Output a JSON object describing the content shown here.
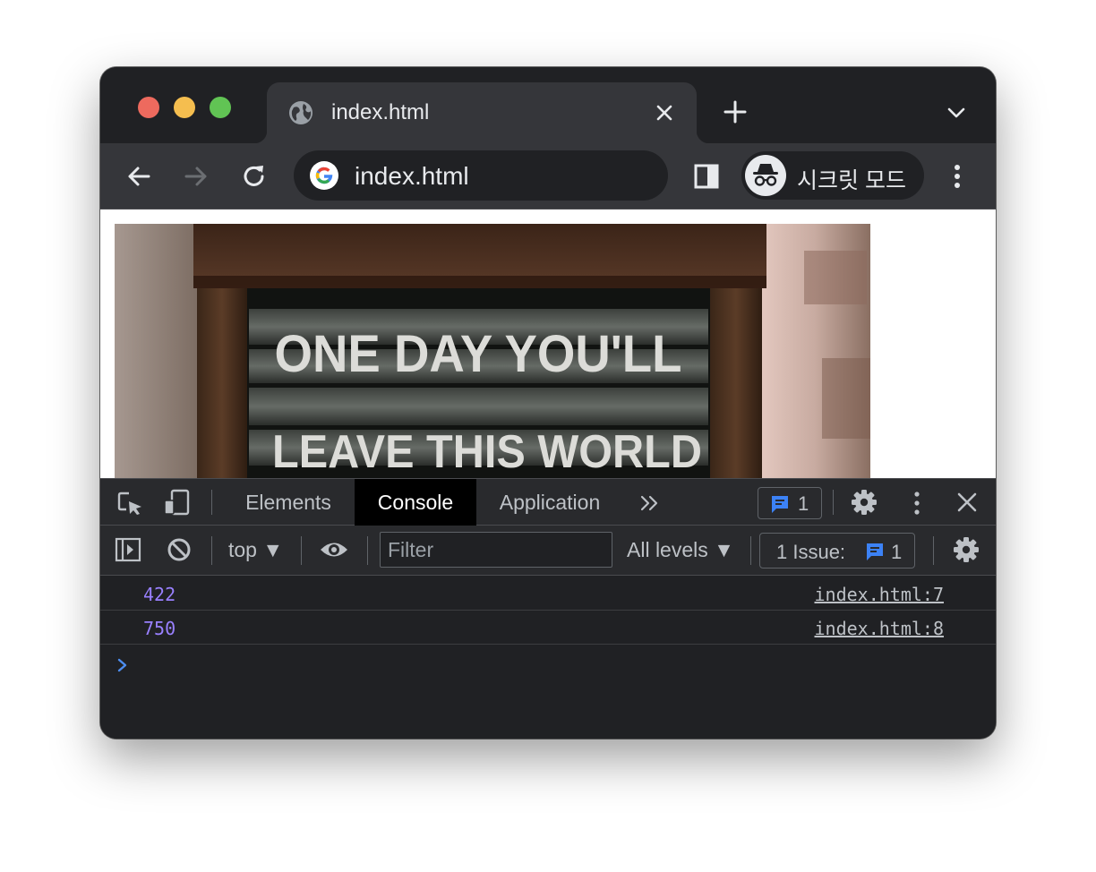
{
  "browser": {
    "tab": {
      "title": "index.html"
    },
    "omnibox": {
      "url": "index.html"
    },
    "incognito_label": "시크릿 모드"
  },
  "page": {
    "image_text": "ONE DAY YOU'LL LEAVE THIS WORLD"
  },
  "devtools": {
    "tabs": [
      {
        "label": "Elements",
        "active": false
      },
      {
        "label": "Console",
        "active": true
      },
      {
        "label": "Application",
        "active": false
      }
    ],
    "issues_badge_count": "1",
    "console_toolbar": {
      "context": "top ▼",
      "filter_placeholder": "Filter",
      "levels": "All levels ▼",
      "issues_label": "1 Issue:",
      "issues_count": "1"
    },
    "logs": [
      {
        "value": "422",
        "source": "index.html:7"
      },
      {
        "value": "750",
        "source": "index.html:8"
      }
    ]
  },
  "colors": {
    "accent_blue": "#3c82f6",
    "log_value": "#9980ff",
    "prompt": "#4d8ef0"
  }
}
